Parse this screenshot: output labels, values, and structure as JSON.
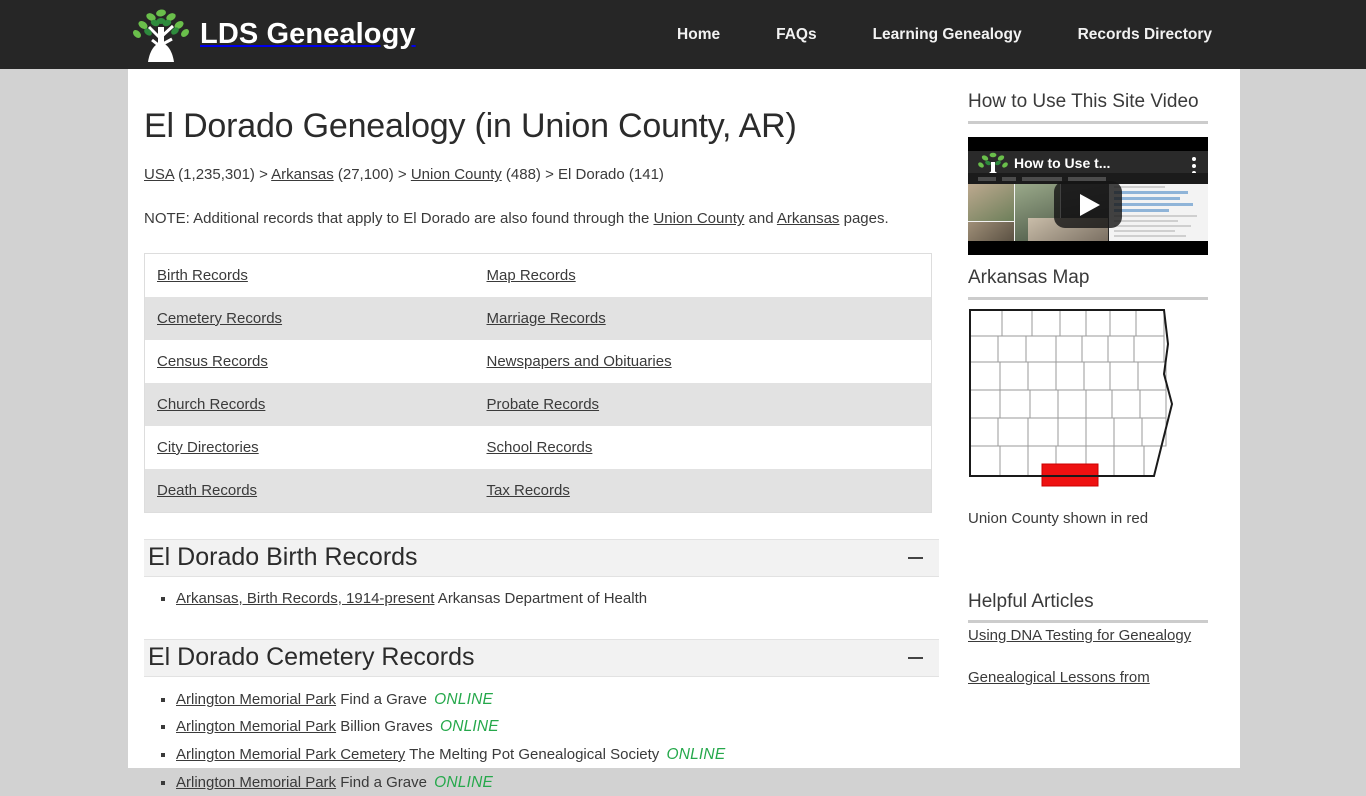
{
  "header": {
    "brand": "LDS Genealogy",
    "logo_icon": "tree-logo-icon",
    "nav": [
      {
        "label": "Home"
      },
      {
        "label": "FAQs"
      },
      {
        "label": "Learning Genealogy"
      },
      {
        "label": "Records Directory"
      }
    ]
  },
  "main": {
    "title": "El Dorado Genealogy (in Union County, AR)",
    "breadcrumb": {
      "usa_label": "USA",
      "usa_count": " (1,235,301) > ",
      "state_label": "Arkansas",
      "state_count": " (27,100) > ",
      "county_label": "Union County",
      "county_count": " (488) > ",
      "city_text": "El Dorado (141)"
    },
    "note": {
      "part1": "NOTE: Additional records that apply to El Dorado are also found through the ",
      "link1": "Union County",
      "part2": " and ",
      "link2": "Arkansas",
      "part3": " pages."
    },
    "index_table": {
      "rows": [
        {
          "left": "Birth Records",
          "right": "Map Records"
        },
        {
          "left": "Cemetery Records",
          "right": "Marriage Records"
        },
        {
          "left": "Census Records",
          "right": "Newspapers and Obituaries"
        },
        {
          "left": "Church Records",
          "right": "Probate Records"
        },
        {
          "left": "City Directories",
          "right": "School Records"
        },
        {
          "left": "Death Records",
          "right": "Tax Records"
        }
      ]
    },
    "sections": [
      {
        "title": "El Dorado Birth Records",
        "toggle_icon": "minus-collapse-icon",
        "items": [
          {
            "link": "Arkansas, Birth Records, 1914-present",
            "source": " Arkansas Department of Health",
            "online": ""
          }
        ]
      },
      {
        "title": "El Dorado Cemetery Records",
        "toggle_icon": "minus-collapse-icon",
        "items": [
          {
            "link": "Arlington Memorial Park",
            "source": " Find a Grave ",
            "online": "ONLINE"
          },
          {
            "link": "Arlington Memorial Park",
            "source": " Billion Graves ",
            "online": "ONLINE"
          },
          {
            "link": "Arlington Memorial Park Cemetery",
            "source": " The Melting Pot Genealogical Society ",
            "online": "ONLINE"
          },
          {
            "link": "Arlington Memorial Park",
            "source": " Find a Grave ",
            "online": "ONLINE"
          }
        ]
      }
    ]
  },
  "sidebar": {
    "video_section_title": "How to Use This Site Video",
    "video_thumb_title": "How to Use t...",
    "video_play_icon": "play-button-icon",
    "map_section_title": "Arkansas Map",
    "map_icon": "arkansas-county-map",
    "map_caption": "Union County shown in red",
    "map_highlight_color": "#ee1111",
    "articles_section_title": "Helpful Articles",
    "articles": [
      {
        "label": "Using DNA Testing for Genealogy"
      },
      {
        "label": "Genealogical Lessons from"
      }
    ]
  }
}
